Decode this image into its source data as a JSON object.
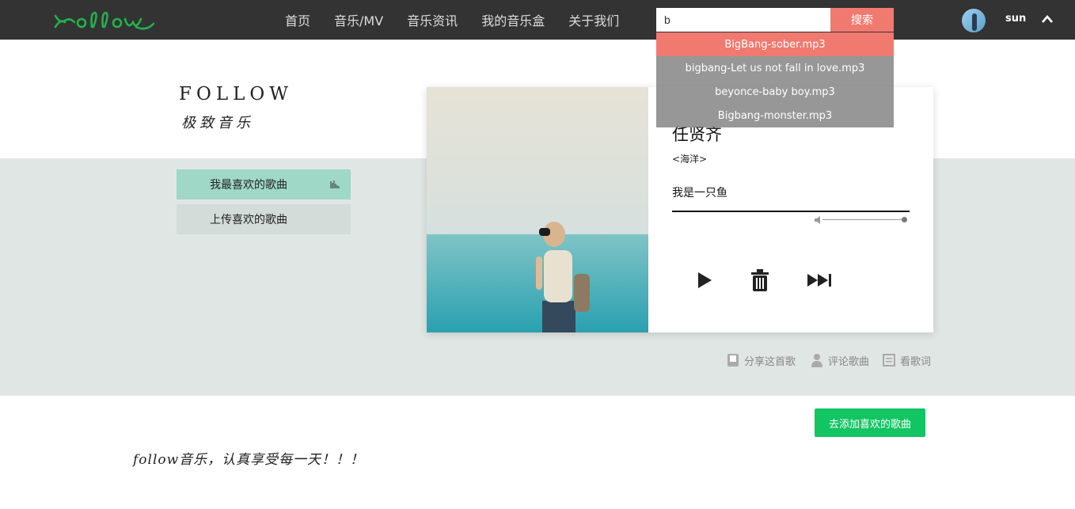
{
  "header": {
    "logo_text": "follow",
    "nav": [
      {
        "label": "首页"
      },
      {
        "label": "音乐/MV"
      },
      {
        "label": "音乐资讯"
      },
      {
        "label": "我的音乐盒"
      },
      {
        "label": "关于我们"
      }
    ],
    "search": {
      "value": "b",
      "button_label": "搜索"
    },
    "username": "sun"
  },
  "search_results": [
    {
      "label": "BigBang-sober.mp3",
      "active": true
    },
    {
      "label": "bigbang-Let us not fall in love.mp3"
    },
    {
      "label": "beyonce-baby boy.mp3"
    },
    {
      "label": "Bigbang-monster.mp3"
    }
  ],
  "brand": {
    "title_en": "FOLLOW",
    "title_cn": "极致音乐"
  },
  "sidebar": {
    "items": [
      {
        "label": "我最喜欢的歌曲"
      },
      {
        "label": "上传喜欢的歌曲"
      }
    ]
  },
  "player": {
    "singer": "任贤齐",
    "album": "<海洋>",
    "song": "我是一只鱼",
    "progress": 1.0,
    "volume": 1.0,
    "controls": [
      "play-icon",
      "trash-icon",
      "next-icon"
    ]
  },
  "actions": [
    {
      "label": "分享这首歌",
      "icon": "share-icon"
    },
    {
      "label": "评论歌曲",
      "icon": "user-icon"
    },
    {
      "label": "看歌词",
      "icon": "lyrics-icon"
    }
  ],
  "add_button": "去添加喜欢的歌曲",
  "slogan": "follow音乐，认真享受每一天！！！",
  "colors": {
    "topbar": "#333333",
    "search_button": "#f07a6f",
    "sidebar_active": "#9fd8c6",
    "band": "#e0e6e4",
    "add_button": "#12c462",
    "logo": "#22b24c"
  }
}
